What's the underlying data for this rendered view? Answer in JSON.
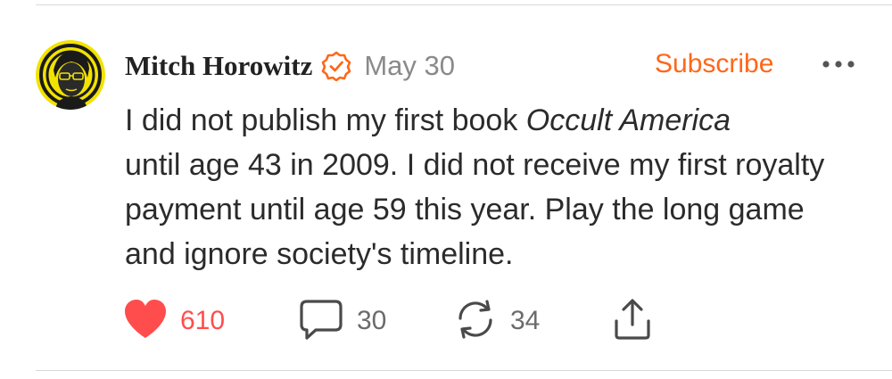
{
  "post": {
    "author": "Mitch Horowitz",
    "date": "May 30",
    "subscribe_label": "Subscribe",
    "body": {
      "line1_text": "I did not publish my first book ",
      "line1_title": "Occult America",
      "rest": "until age 43 in 2009. I did not receive my first royalty payment until age 59 this year. Play the long game and ignore society's timeline."
    },
    "actions": {
      "likes": "610",
      "comments": "30",
      "restacks": "34"
    }
  },
  "icons": {
    "verified": "verified-check-icon",
    "more": "more-dots-icon",
    "like": "heart-icon",
    "comment": "comment-bubble-icon",
    "restack": "restack-arrows-icon",
    "share": "share-upload-icon"
  },
  "colors": {
    "accent": "#ff6719",
    "like": "#ff4d4d",
    "text": "#2b2b2b",
    "muted": "#8a8a8a",
    "avatar_bg": "#f2e200"
  }
}
